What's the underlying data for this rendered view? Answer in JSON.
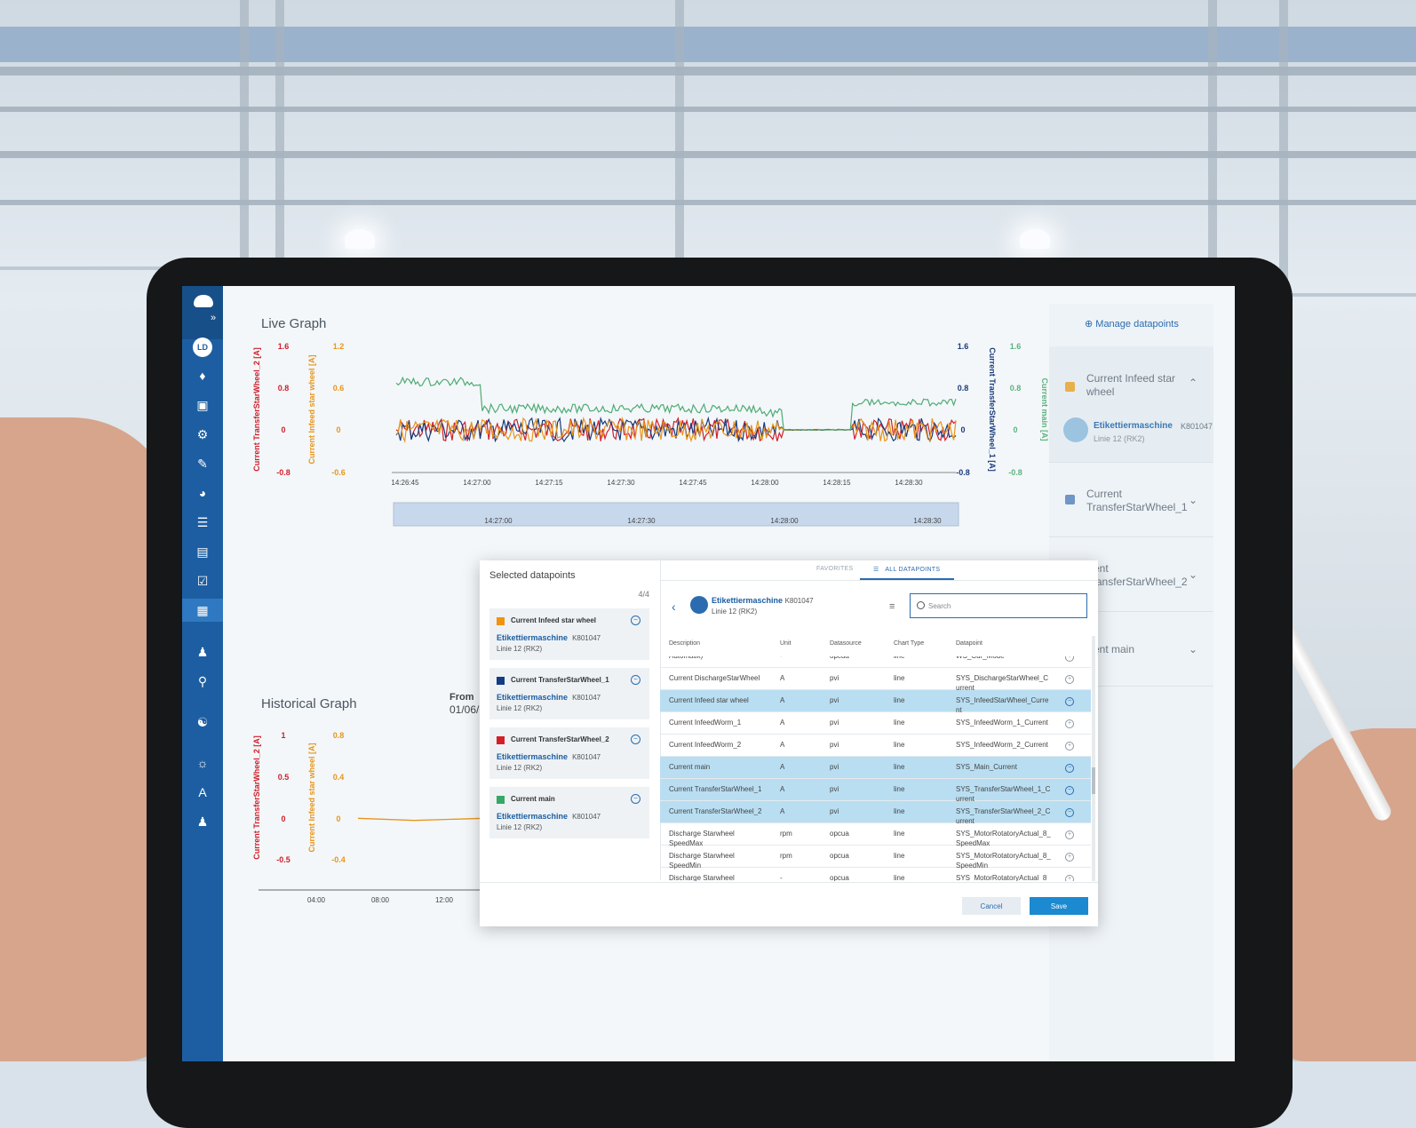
{
  "sidebar": {
    "avatar": "LD",
    "expand_glyph": "»"
  },
  "live_graph": {
    "title": "Live Graph",
    "chart_data": {
      "type": "line",
      "x_ticks": [
        "14:26:45",
        "14:27:00",
        "14:27:15",
        "14:27:30",
        "14:27:45",
        "14:28:00",
        "14:28:15",
        "14:28:30"
      ],
      "navigator_ticks": [
        "14:27:00",
        "14:27:30",
        "14:28:00",
        "14:28:30"
      ],
      "axes": [
        {
          "label": "Current TransferStarWheel_2 [A]",
          "ticks": [
            "1.6",
            "0.8",
            "0",
            "-0.8"
          ],
          "ylim": [
            -0.8,
            1.6
          ],
          "color": "#d0202a",
          "side": "left"
        },
        {
          "label": "Current Infeed star wheel [A]",
          "ticks": [
            "1.2",
            "0.6",
            "0",
            "-0.6"
          ],
          "ylim": [
            -0.6,
            1.2
          ],
          "color": "#e8951a",
          "side": "left"
        },
        {
          "label": "Current TransferStarWheel_1 [A]",
          "ticks": [
            "1.6",
            "0.8",
            "0",
            "-0.8"
          ],
          "ylim": [
            -0.8,
            1.6
          ],
          "color": "#1a3a7a",
          "side": "right"
        },
        {
          "label": "Current main [A]",
          "ticks": [
            "1.6",
            "0.8",
            "0",
            "-0.8"
          ],
          "ylim": [
            -0.8,
            1.6
          ],
          "color": "#5cb27c",
          "side": "right"
        }
      ],
      "series": [
        {
          "name": "Current main",
          "color": "#4fab73",
          "approx_level": 1.1
        },
        {
          "name": "Current Infeed star wheel",
          "color": "#e8951a",
          "approx_level": 0.0
        },
        {
          "name": "Current TransferStarWheel_1",
          "color": "#1a3a7a",
          "approx_level": 0.0
        },
        {
          "name": "Current TransferStarWheel_2",
          "color": "#d0202a",
          "approx_level": 0.0
        }
      ]
    }
  },
  "historical_graph": {
    "title": "Historical Graph",
    "from_label": "From",
    "from_value": "01/06/",
    "chart_data": {
      "type": "line",
      "x_ticks": [
        "04:00",
        "08:00",
        "12:00"
      ],
      "axes": [
        {
          "label": "Current TransferStarWheel_2 [A]",
          "ticks": [
            "1",
            "0.5",
            "0",
            "-0.5"
          ],
          "ylim": [
            -0.5,
            1
          ],
          "color": "#d0202a"
        },
        {
          "label": "Current Infeed star wheel [A]",
          "ticks": [
            "0.8",
            "0.4",
            "0",
            "-0.4"
          ],
          "ylim": [
            -0.4,
            0.8
          ],
          "color": "#e8951a"
        }
      ],
      "series": [
        {
          "name": "Current Infeed star wheel",
          "color": "#e8951a",
          "x": [
            0,
            3,
            6.8,
            10
          ],
          "values": [
            0,
            -0.02,
            0.0,
            0.2
          ]
        },
        {
          "name": "Current TransferStarWheel_2",
          "color": "#d0202a",
          "x": [
            8.5,
            10
          ],
          "values": [
            0.05,
            -0.1
          ]
        }
      ]
    }
  },
  "right_panel": {
    "manage_label": "Manage datapoints",
    "items": [
      {
        "label": "Current Infeed star wheel",
        "machine": "Etikettiermaschine",
        "machine_id": "K801047",
        "line": "Linie 12 (RK2)"
      },
      {
        "label": "Current TransferStarWheel_1"
      },
      {
        "label": "rrent TransferStarWheel_2"
      },
      {
        "label": "rrent main"
      }
    ]
  },
  "dialog": {
    "selected_title": "Selected datapoints",
    "count": "4/4",
    "selected": [
      {
        "name": "Current Infeed star wheel",
        "color": "#f0930e",
        "machine": "Etikettiermaschine",
        "machine_id": "K801047",
        "line": "Linie 12 (RK2)"
      },
      {
        "name": "Current TransferStarWheel_1",
        "color": "#143c84",
        "machine": "Etikettiermaschine",
        "machine_id": "K801047",
        "line": "Linie 12 (RK2)"
      },
      {
        "name": "Current TransferStarWheel_2",
        "color": "#d51f28",
        "machine": "Etikettiermaschine",
        "machine_id": "K801047",
        "line": "Linie 12 (RK2)"
      },
      {
        "name": "Current main",
        "color": "#35a866",
        "machine": "Etikettiermaschine",
        "machine_id": "K801047",
        "line": "Linie 12 (RK2)"
      }
    ],
    "tabs": [
      "FAVORITES",
      "ALL DATAPOINTS"
    ],
    "breadcrumb": {
      "machine": "Etikettiermaschine",
      "machine_id": "K801047",
      "line": "Linie 12 (RK2)"
    },
    "search_placeholder": "Search",
    "columns": [
      "Description",
      "Unit",
      "Datasource",
      "Chart Type",
      "Datapoint"
    ],
    "rows": [
      {
        "desc": "Automatik)",
        "unit": "-",
        "source": "opcua",
        "type": "line",
        "dp": "WS_Cur_Mode",
        "sel": false
      },
      {
        "desc": "Current DischargeStarWheel",
        "unit": "A",
        "source": "pvi",
        "type": "line",
        "dp": "SYS_DischargeStarWheel_Current",
        "sel": false
      },
      {
        "desc": "Current Infeed star wheel",
        "unit": "A",
        "source": "pvi",
        "type": "line",
        "dp": "SYS_InfeedStarWheel_Current",
        "sel": true
      },
      {
        "desc": "Current InfeedWorm_1",
        "unit": "A",
        "source": "pvi",
        "type": "line",
        "dp": "SYS_InfeedWorm_1_Current",
        "sel": false
      },
      {
        "desc": "Current InfeedWorm_2",
        "unit": "A",
        "source": "pvi",
        "type": "line",
        "dp": "SYS_InfeedWorm_2_Current",
        "sel": false
      },
      {
        "desc": "Current main",
        "unit": "A",
        "source": "pvi",
        "type": "line",
        "dp": "SYS_Main_Current",
        "sel": true
      },
      {
        "desc": "Current TransferStarWheel_1",
        "unit": "A",
        "source": "pvi",
        "type": "line",
        "dp": "SYS_TransferStarWheel_1_Current",
        "sel": true
      },
      {
        "desc": "Current TransferStarWheel_2",
        "unit": "A",
        "source": "pvi",
        "type": "line",
        "dp": "SYS_TransferStarWheel_2_Current",
        "sel": true
      },
      {
        "desc": "Discharge Starwheel SpeedMax",
        "unit": "rpm",
        "source": "opcua",
        "type": "line",
        "dp": "SYS_MotorRotatoryActual_8_SpeedMax",
        "sel": false
      },
      {
        "desc": "Discharge Starwheel SpeedMin",
        "unit": "rpm",
        "source": "opcua",
        "type": "line",
        "dp": "SYS_MotorRotatoryActual_8_SpeedMin",
        "sel": false
      },
      {
        "desc": "Discharge Starwheel",
        "unit": "-",
        "source": "opcua",
        "type": "line",
        "dp": "SYS_MotorRotatoryActual_8",
        "sel": false
      }
    ],
    "cancel_label": "Cancel",
    "save_label": "Save"
  }
}
